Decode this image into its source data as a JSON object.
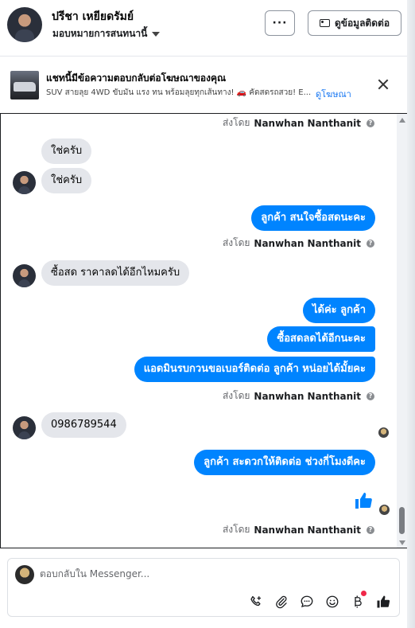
{
  "header": {
    "contact_name": "ปรีชา เหยียดรัมย์",
    "stage_label": "มอบหมายการสนทนานี้",
    "more_label": "···",
    "contact_info_label": "ดูข้อมูลติดต่อ"
  },
  "ad_banner": {
    "title": "แชทนี้มีข้อความตอบกลับต่อโฆษณาของคุณ",
    "description": "SUV สายลุย 4WD ขับมัน แรง ทน พร้อมลุยทุกเส้นทาง! 🚗 คัดสดรถสวย! E...",
    "link_label": "ดูโฆษณา"
  },
  "conversation": {
    "agent_name": "Nanwhan Nanthanit",
    "sent_by_prefix": "ส่งโดย",
    "messages": [
      {
        "from": "customer",
        "text": "ใช่ครับ"
      },
      {
        "from": "customer",
        "text": "ใช่ครับ"
      },
      {
        "from": "page",
        "text": "ลูกค้า สนใจซื้อสดนะคะ"
      },
      {
        "from": "customer",
        "text": "ซื้อสด ราคาลดได้อีกไหมครับ"
      },
      {
        "from": "page",
        "text": "ได้ค่ะ  ลูกค้า"
      },
      {
        "from": "page",
        "text": "ซื้อสดลดได้อีกนะคะ"
      },
      {
        "from": "page",
        "text": "แอดมินรบกวนขอเบอร์ติดต่อ ลูกค้า หน่อยได้มั้ยคะ"
      },
      {
        "from": "customer",
        "text": "0986789544"
      },
      {
        "from": "page",
        "text": "ลูกค้า สะดวกให้ติดต่อ ช่วงกี่โมงดีคะ"
      }
    ]
  },
  "composer": {
    "placeholder": "ตอบกลับใน Messenger..."
  },
  "colors": {
    "outgoing_bubble": "#0084ff",
    "incoming_bubble": "#e4e6eb",
    "link": "#1877f2"
  }
}
